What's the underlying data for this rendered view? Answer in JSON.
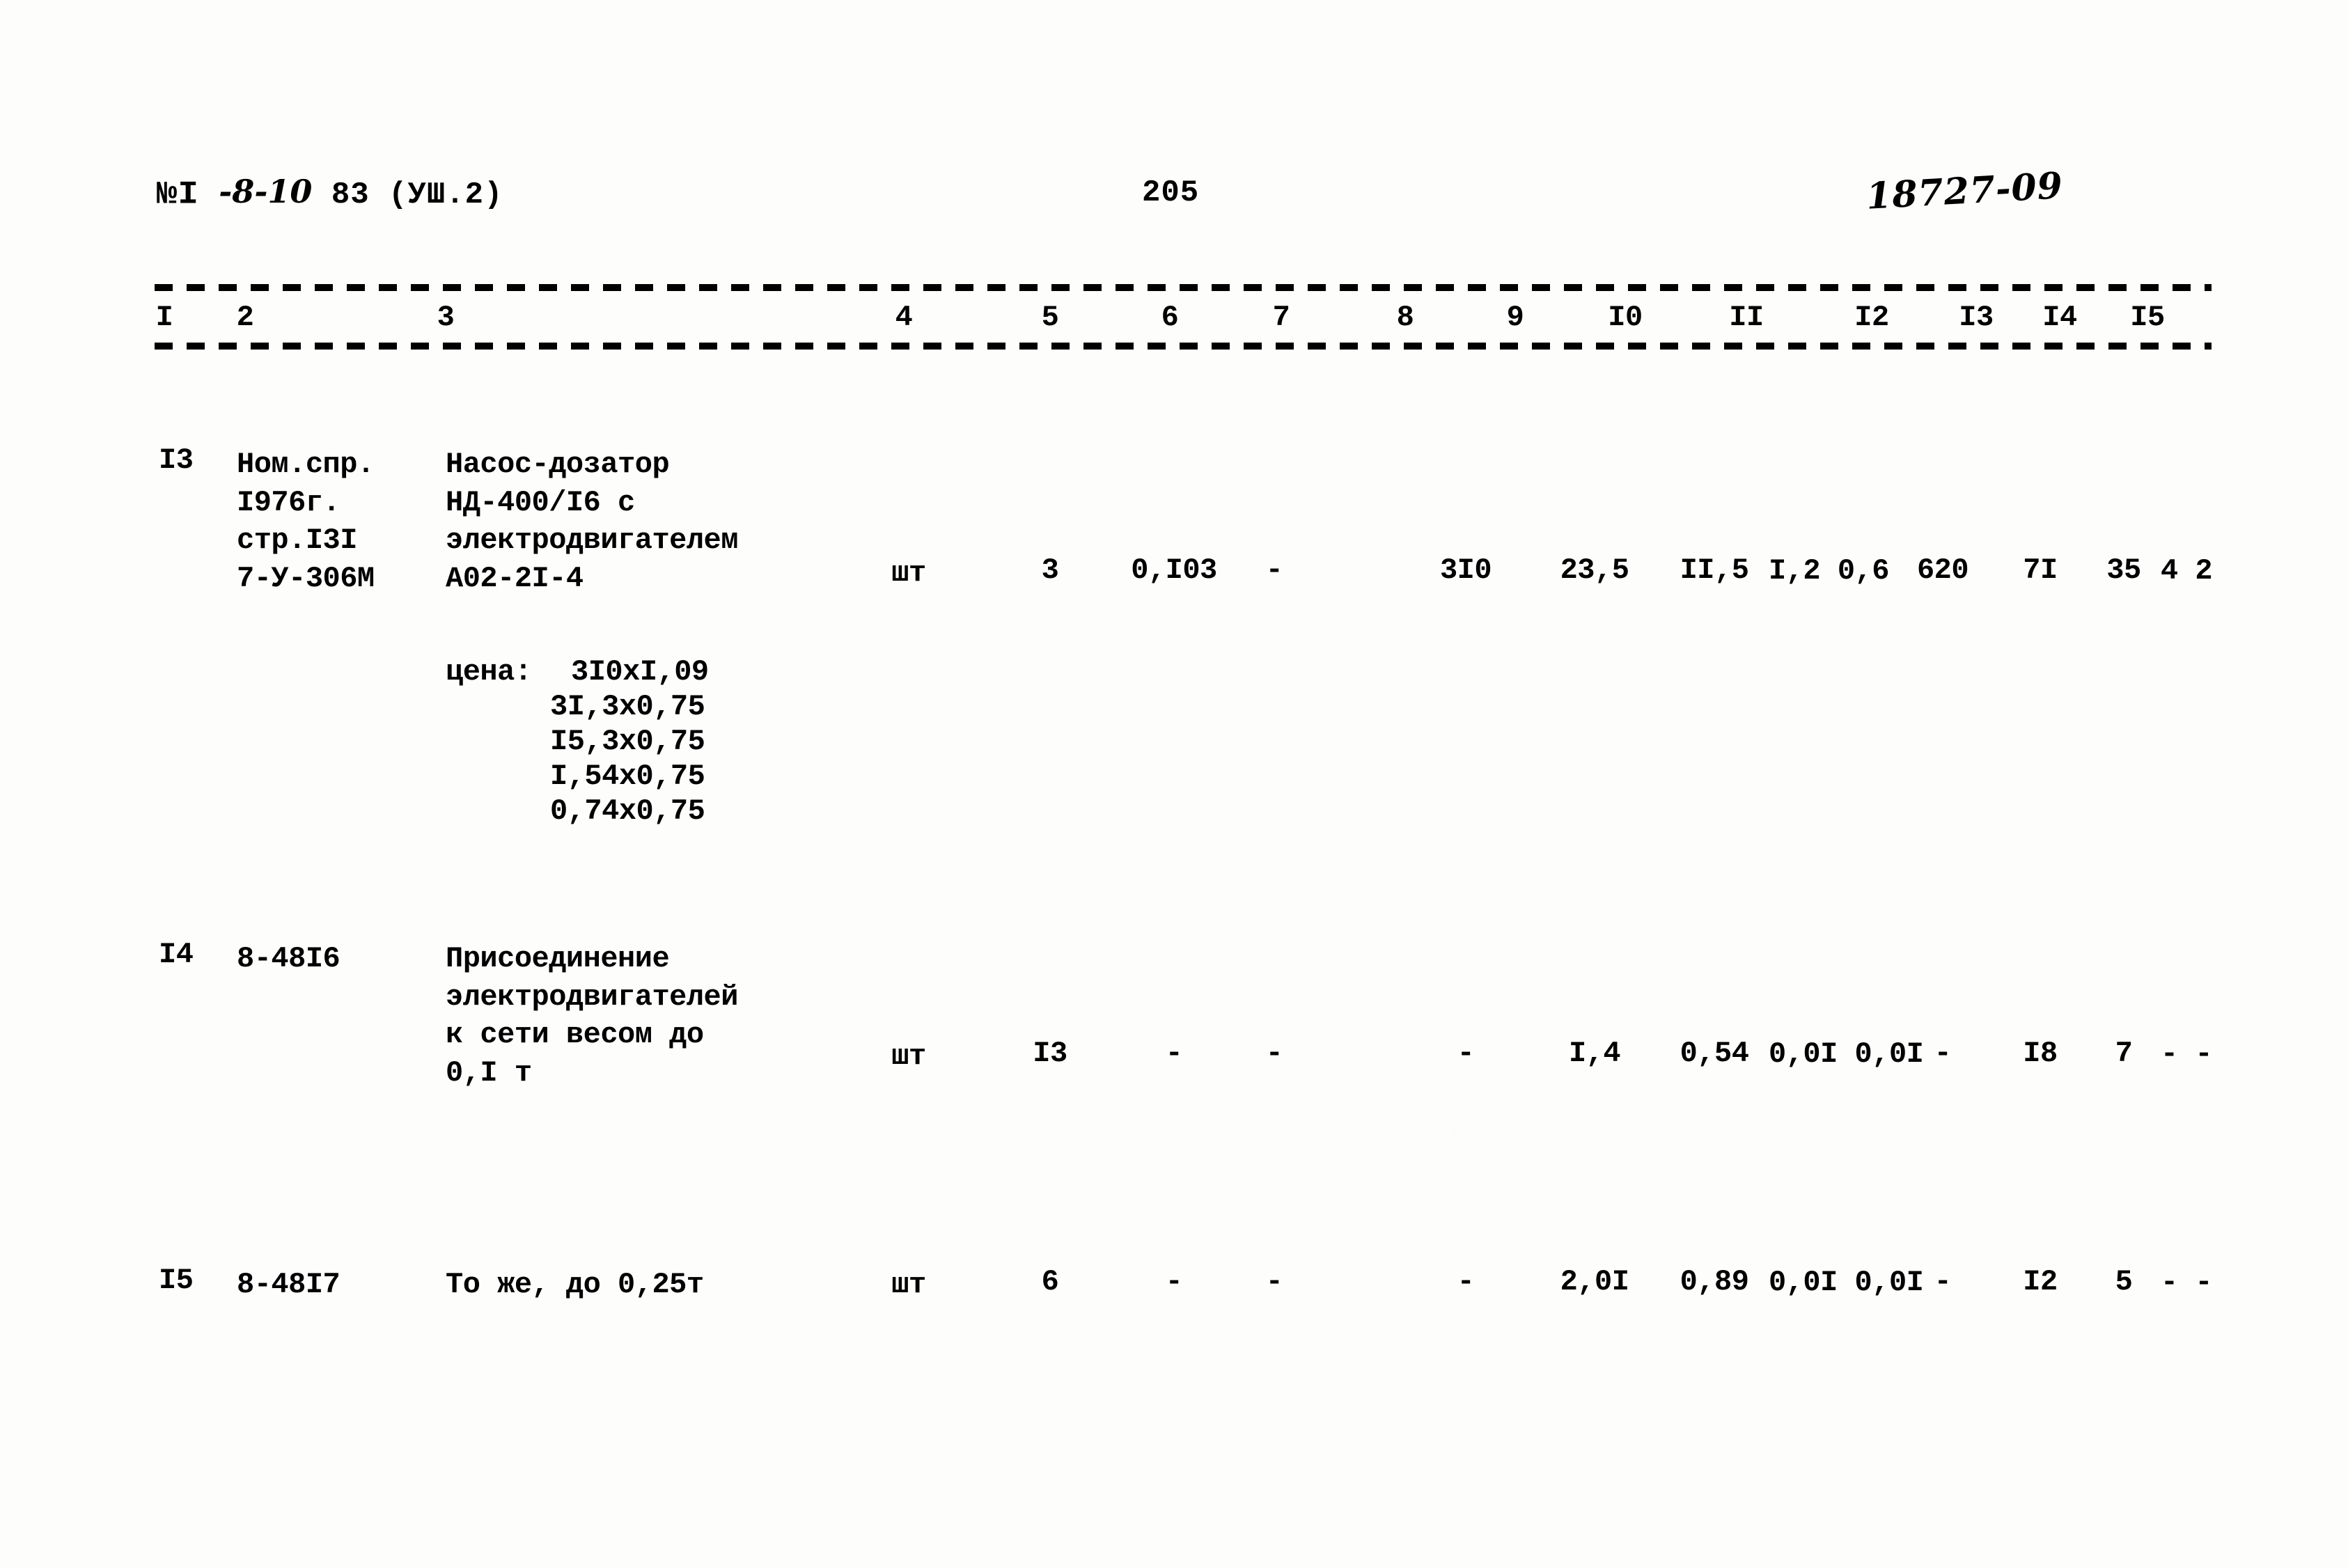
{
  "header": {
    "doc_code": "№I -8-10 83 (УШ.2)",
    "doc_code_prefix": "№I",
    "doc_code_hand": "-8-10",
    "doc_code_suffix": "83 (УШ.2)",
    "page_number": "205",
    "stamp_number": "18727-09"
  },
  "table": {
    "column_numbers": [
      "I",
      "2",
      "3",
      "4",
      "5",
      "6",
      "7",
      "8",
      "9",
      "I0",
      "II",
      "I2",
      "I3",
      "I4",
      "I5"
    ],
    "rows": [
      {
        "num": "I3",
        "code": "Ном.спр.\nI976г.\nстр.I3I\n7-У-306М",
        "description": "Насос-дозатор\nНД-400/I6 с\nэлектродвигателем\nА02-2I-4",
        "unit": "шт",
        "qty": "3",
        "c6": "0,I03",
        "c7": "-",
        "c8": "",
        "c9": "3I0",
        "c10": "23,5",
        "c11": "II,5",
        "c12_top": "I,2",
        "c12_bottom": "0,6",
        "c13": "620",
        "c14": "7I",
        "c15": "35",
        "c16_top": "4",
        "c16_bottom": "2",
        "price_label": "цена:",
        "price_lines": [
          "3I0xI,09",
          "3I,3x0,75",
          "I5,3x0,75",
          "I,54x0,75",
          "0,74x0,75"
        ]
      },
      {
        "num": "I4",
        "code": "8-48I6",
        "description": "Присоединение\nэлектродвигателей\nк сети весом до\n0,I т",
        "unit": "шт",
        "qty": "I3",
        "c6": "-",
        "c7": "-",
        "c8": "",
        "c9": "-",
        "c10": "I,4",
        "c11": "0,54",
        "c12_top": "0,0I",
        "c12_bottom": "0,0I",
        "c13": "-",
        "c14": "I8",
        "c15": "7",
        "c16_top": "-",
        "c16_bottom": "-"
      },
      {
        "num": "I5",
        "code": "8-48I7",
        "description": "То же, до 0,25т",
        "unit": "шт",
        "qty": "6",
        "c6": "-",
        "c7": "-",
        "c8": "",
        "c9": "-",
        "c10": "2,0I",
        "c11": "0,89",
        "c12_top": "0,0I",
        "c12_bottom": "0,0I",
        "c13": "-",
        "c14": "I2",
        "c15": "5",
        "c16_top": "-",
        "c16_bottom": "-"
      }
    ]
  }
}
